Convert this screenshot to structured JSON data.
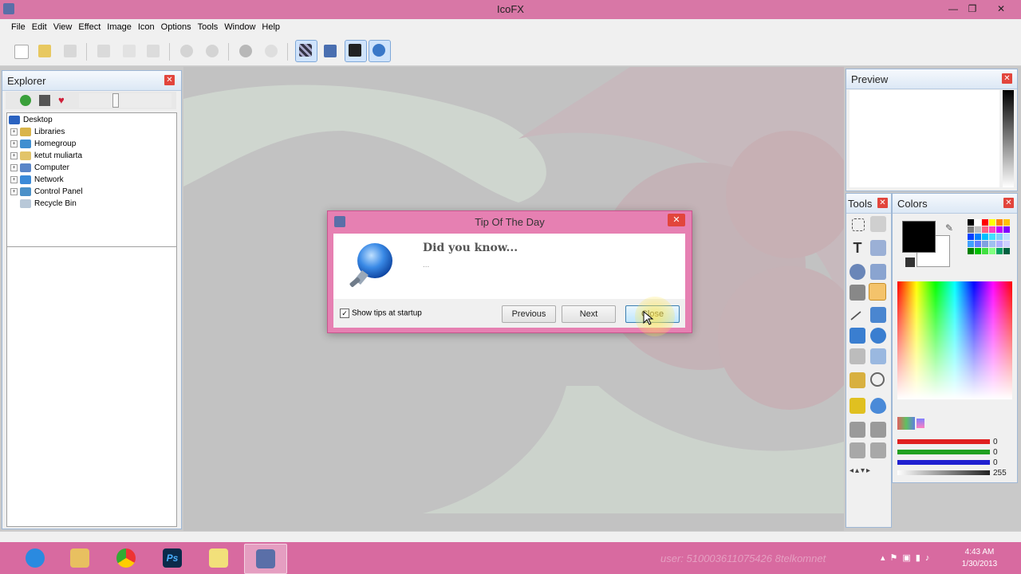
{
  "window": {
    "title": "IcoFX"
  },
  "menu": [
    "File",
    "Edit",
    "View",
    "Effect",
    "Image",
    "Icon",
    "Options",
    "Tools",
    "Window",
    "Help"
  ],
  "explorer": {
    "title": "Explorer",
    "tree": [
      "Desktop",
      "Libraries",
      "Homegroup",
      "ketut muliarta",
      "Computer",
      "Network",
      "Control Panel",
      "Recycle Bin"
    ]
  },
  "preview": {
    "title": "Preview"
  },
  "tools_panel": {
    "title": "Tools"
  },
  "colors_panel": {
    "title": "Colors",
    "primary": "#000000",
    "secondary": "#ffffff",
    "red_value": "0",
    "green_value": "0",
    "blue_value": "0",
    "alpha_value": "255"
  },
  "dialog": {
    "title": "Tip Of The Day",
    "heading": "Did you know...",
    "tip_text": "...",
    "show_tips_label": "Show tips at startup",
    "show_tips_checked": true,
    "previous_label": "Previous",
    "next_label": "Next",
    "close_label": "Close"
  },
  "taskbar": {
    "apps": [
      "internet-explorer",
      "file-explorer",
      "chrome",
      "photoshop",
      "sticky-notes",
      "icofx"
    ],
    "time": "4:43 AM",
    "date": "1/30/2013",
    "watermark": "user: 510003611075426 8telkomnet"
  },
  "colors": {
    "accent": "#d877a6",
    "panel_border": "#9fb8d6",
    "close_red": "#e2453c"
  }
}
